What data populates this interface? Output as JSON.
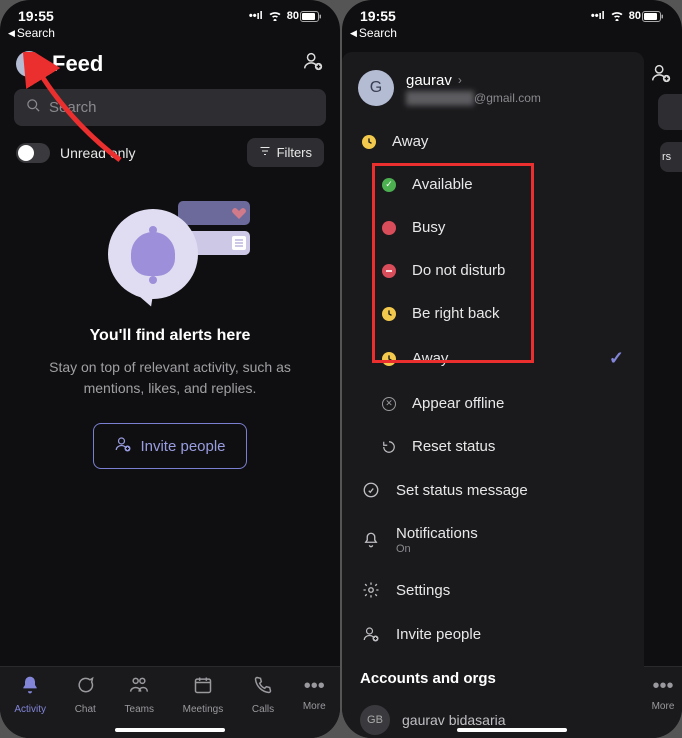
{
  "status": {
    "time": "19:55",
    "battery": "80"
  },
  "back_search": "Search",
  "screen1": {
    "avatar_letter": "G",
    "title": "Feed",
    "search_placeholder": "Search",
    "unread_label": "Unread only",
    "filters_label": "Filters",
    "empty_title": "You'll find alerts here",
    "empty_sub": "Stay on top of relevant activity, such as mentions, likes, and replies.",
    "invite_label": "Invite people",
    "tabs": [
      {
        "label": "Activity"
      },
      {
        "label": "Chat"
      },
      {
        "label": "Teams"
      },
      {
        "label": "Meetings"
      },
      {
        "label": "Calls"
      },
      {
        "label": "More"
      }
    ]
  },
  "screen2": {
    "avatar_letter": "G",
    "name": "gaurav",
    "email_suffix": "@gmail.com",
    "current_status": "Away",
    "statuses": [
      {
        "label": "Available"
      },
      {
        "label": "Busy"
      },
      {
        "label": "Do not disturb"
      },
      {
        "label": "Be right back"
      },
      {
        "label": "Away"
      }
    ],
    "appear_offline": "Appear offline",
    "reset_status": "Reset status",
    "set_status_message": "Set status message",
    "notifications_label": "Notifications",
    "notifications_value": "On",
    "settings": "Settings",
    "invite_people": "Invite people",
    "accounts_title": "Accounts and orgs",
    "account_name": "gaurav bidasaria",
    "filters_peek": "rs",
    "more_tab": "More"
  }
}
